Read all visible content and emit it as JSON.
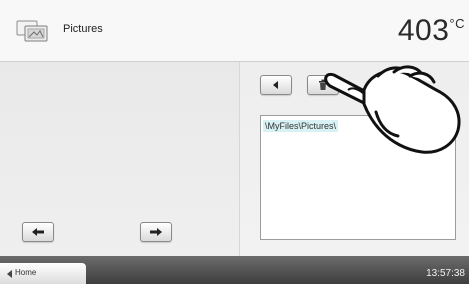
{
  "header": {
    "title": "Pictures",
    "temperature": "403",
    "unit": "°C",
    "icon": "pictures-folder-icon"
  },
  "toolbar": {
    "back_icon": "arrow-left-icon",
    "delete_icon": "trash-icon"
  },
  "file_list": {
    "items": [
      "\\MyFiles\\Pictures\\"
    ]
  },
  "navigation": {
    "prev_icon": "arrow-left-icon",
    "next_icon": "arrow-right-icon"
  },
  "footer": {
    "home_label": "Home",
    "time": "13:57:38"
  },
  "overlay": {
    "hand": "pointing-hand-icon"
  },
  "colors": {
    "selection": "#d8f1f4",
    "footer_bg": "#4a4a4a"
  }
}
